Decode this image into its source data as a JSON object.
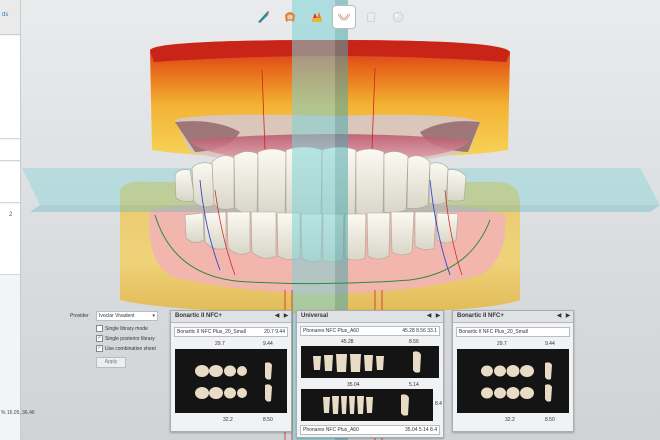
{
  "sidebar": {
    "label": "ds",
    "number": "2",
    "coords": "% 16.05, 36.46"
  },
  "toolbar": {
    "icons": [
      "scalpel-tool-icon",
      "jaw-model-icon",
      "colored-teeth-icon",
      "tooth-arch-icon",
      "single-tooth-icon",
      "sphere-icon"
    ],
    "active_index": 3
  },
  "options": {
    "provider_label": "Provider",
    "provider_value": "Ivoclar Vivadent",
    "checkboxes": [
      {
        "label": "Single library mode",
        "checked": false
      },
      {
        "label": "Single posterior library",
        "checked": true
      },
      {
        "label": "Use combination sheet",
        "checked": true
      }
    ],
    "apply_label": "Apply"
  },
  "panels": {
    "left": {
      "title": "Bonartic II NFC+",
      "select": "Bonartic II NFC Plus_20_Small",
      "select_value": "20.7  9.44",
      "top_w": "29.7",
      "top_h": "9.44",
      "bot_w": "32.2",
      "bot_h": "8.50"
    },
    "center": {
      "title": "Universal",
      "select_top": "Phonares NFC Plus_A60",
      "select_top_value": "45.28  8.56  33.1",
      "upper_w": "45.28",
      "upper_h": "8.56",
      "mid_w": "35.04",
      "mid_h": "5.14",
      "side_label": "8.4",
      "select_bot": "Phonares NFC Plus_A60",
      "select_bot_value": "35.04  5.14  8.4"
    },
    "right": {
      "title": "Bonartic II NFC+",
      "select": "Bonartic II NFC Plus_20_Small",
      "top_w": "29.7",
      "top_h": "9.44",
      "bot_w": "32.2",
      "bot_h": "8.50"
    }
  }
}
